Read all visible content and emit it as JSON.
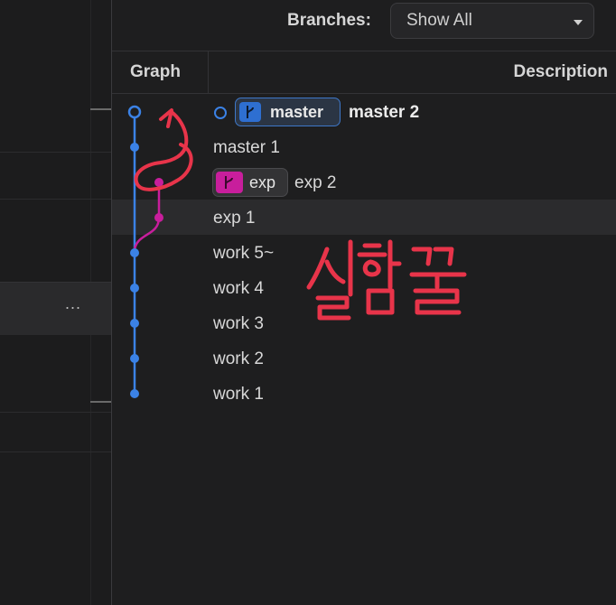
{
  "toolbar": {
    "branches_label": "Branches:",
    "branches_value": "Show All"
  },
  "columns": {
    "graph": "Graph",
    "description": "Description"
  },
  "commits": [
    {
      "message": "master 2",
      "branch_badge": "master",
      "is_head": true
    },
    {
      "message": "master 1"
    },
    {
      "message": "exp 2",
      "branch_badge": "exp"
    },
    {
      "message": "exp 1",
      "selected": true
    },
    {
      "message": "work 5~"
    },
    {
      "message": "work 4"
    },
    {
      "message": "work 3"
    },
    {
      "message": "work 2"
    },
    {
      "message": "work 1"
    }
  ],
  "left_panel": {
    "more_label": "..."
  },
  "annotation": {
    "handwritten_text": "실험끝"
  },
  "colors": {
    "master_branch": "#3b82e6",
    "exp_branch": "#c81e9c",
    "annotation_red": "#e8344a",
    "background": "#1e1e1f"
  },
  "icons": [
    "branch-icon",
    "chevron-down-icon",
    "more-icon"
  ]
}
